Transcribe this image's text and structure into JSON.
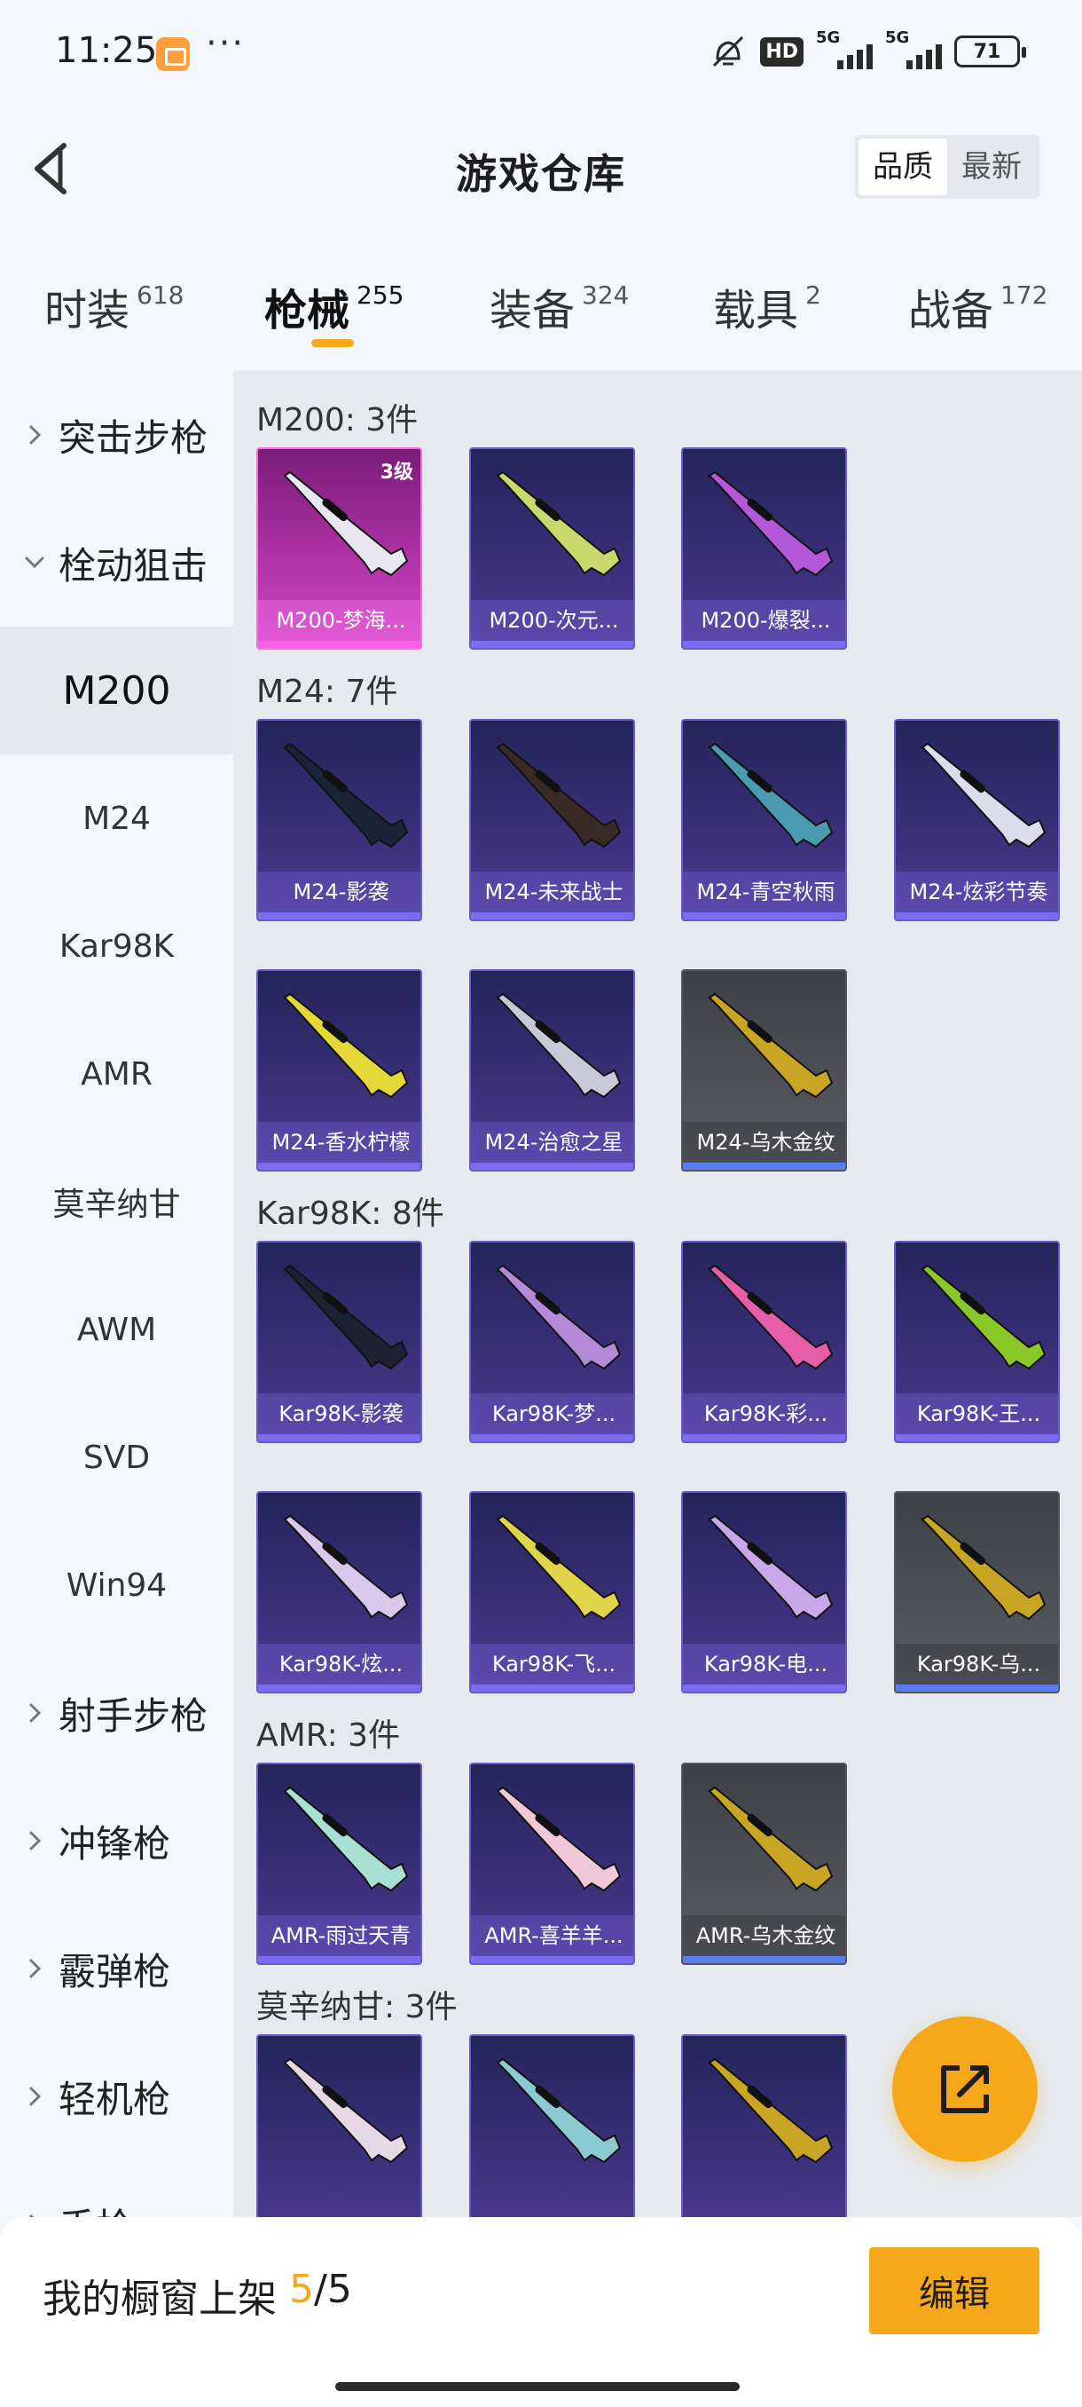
{
  "status_bar": {
    "time": "11:25",
    "more": "···",
    "hd": "HD",
    "sig1": "5G",
    "sig2": "5G",
    "battery": "71"
  },
  "header": {
    "title": "游戏仓库",
    "sort": [
      "品质",
      "最新"
    ]
  },
  "tabs": [
    {
      "label": "时装",
      "count": "618"
    },
    {
      "label": "枪械",
      "count": "255"
    },
    {
      "label": "装备",
      "count": "324"
    },
    {
      "label": "载具",
      "count": "2"
    },
    {
      "label": "战备",
      "count": "172"
    }
  ],
  "sidebar": {
    "items": [
      {
        "label": "突击步枪",
        "type": "group",
        "expanded": false
      },
      {
        "label": "栓动狙击",
        "type": "group",
        "expanded": true
      },
      {
        "label": "M200",
        "type": "sub",
        "selected": true
      },
      {
        "label": "M24",
        "type": "sub"
      },
      {
        "label": "Kar98K",
        "type": "sub"
      },
      {
        "label": "AMR",
        "type": "sub"
      },
      {
        "label": "莫辛纳甘",
        "type": "sub"
      },
      {
        "label": "AWM",
        "type": "sub"
      },
      {
        "label": "SVD",
        "type": "sub"
      },
      {
        "label": "Win94",
        "type": "sub"
      },
      {
        "label": "射手步枪",
        "type": "group",
        "expanded": false
      },
      {
        "label": "冲锋枪",
        "type": "group",
        "expanded": false
      },
      {
        "label": "霰弹枪",
        "type": "group",
        "expanded": false
      },
      {
        "label": "轻机枪",
        "type": "group",
        "expanded": false
      },
      {
        "label": "手枪",
        "type": "group",
        "expanded": false
      }
    ]
  },
  "groups": [
    {
      "title": "M200: 3件",
      "items": [
        {
          "name": "M200-梦海...",
          "rarity": "pink",
          "badge": "3级",
          "color": "#e8e6f0"
        },
        {
          "name": "M200-次元...",
          "rarity": "purple",
          "color": "#c9d86a"
        },
        {
          "name": "M200-爆裂...",
          "rarity": "purple",
          "color": "#b457d8"
        }
      ]
    },
    {
      "title": "M24: 7件",
      "items": [
        {
          "name": "M24-影袭",
          "rarity": "purple",
          "color": "#1b2436"
        },
        {
          "name": "M24-未来战士",
          "rarity": "purple",
          "color": "#3a2a24"
        },
        {
          "name": "M24-青空秋雨",
          "rarity": "purple",
          "color": "#4a9ab0"
        },
        {
          "name": "M24-炫彩节奏",
          "rarity": "purple",
          "color": "#dcdcec"
        },
        {
          "name": "M24-香水柠檬",
          "rarity": "purple",
          "color": "#e4d838"
        },
        {
          "name": "M24-治愈之星",
          "rarity": "purple",
          "color": "#c8c8d8"
        },
        {
          "name": "M24-乌木金纹",
          "rarity": "gray",
          "color": "#c9a524"
        }
      ]
    },
    {
      "title": "Kar98K: 8件",
      "items": [
        {
          "name": "Kar98K-影袭",
          "rarity": "purple",
          "color": "#1c2232"
        },
        {
          "name": "Kar98K-梦...",
          "rarity": "purple",
          "color": "#b48ad8"
        },
        {
          "name": "Kar98K-彩...",
          "rarity": "purple",
          "color": "#e65ea8"
        },
        {
          "name": "Kar98K-王...",
          "rarity": "purple",
          "color": "#8ac82a"
        },
        {
          "name": "Kar98K-炫...",
          "rarity": "purple",
          "color": "#d8c8ec"
        },
        {
          "name": "Kar98K-飞...",
          "rarity": "purple",
          "color": "#e0d44a"
        },
        {
          "name": "Kar98K-电...",
          "rarity": "purple",
          "color": "#c8a8e8"
        },
        {
          "name": "Kar98K-乌...",
          "rarity": "gray",
          "color": "#c9a524"
        }
      ]
    },
    {
      "title": "AMR: 3件",
      "items": [
        {
          "name": "AMR-雨过天青",
          "rarity": "purple",
          "color": "#a8e0d4"
        },
        {
          "name": "AMR-喜羊羊...",
          "rarity": "purple",
          "color": "#f0c8d8"
        },
        {
          "name": "AMR-乌木金纹",
          "rarity": "gray",
          "color": "#c9a524"
        }
      ]
    },
    {
      "title": "莫辛纳甘: 3件",
      "items": [
        {
          "name": "",
          "rarity": "purple",
          "color": "#e6d8e4"
        },
        {
          "name": "",
          "rarity": "purple",
          "color": "#8acad0"
        },
        {
          "name": "",
          "rarity": "purple",
          "color": "#c9a524"
        }
      ]
    }
  ],
  "bottom": {
    "showcase_label": "我的橱窗上架",
    "current": "5",
    "sep": "/",
    "total": "5",
    "edit": "编辑"
  },
  "colors": {
    "accent": "#f6a81b",
    "purple_rarity": "#6a58c8",
    "pink_rarity": "#ff5fe6"
  }
}
